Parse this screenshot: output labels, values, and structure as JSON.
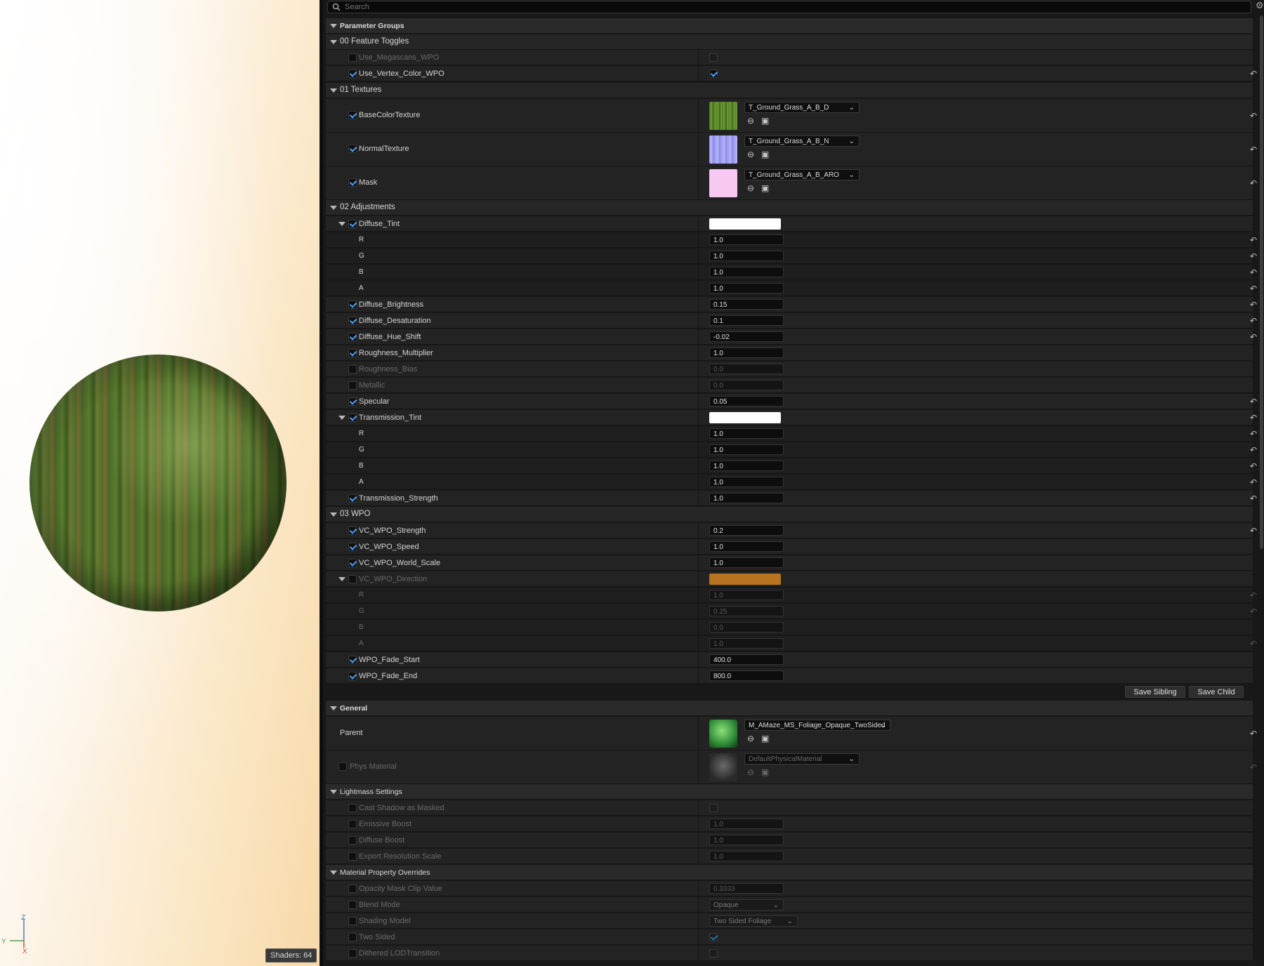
{
  "search": {
    "placeholder": "Search"
  },
  "viewport": {
    "shaders_label": "Shaders: 64",
    "axis": {
      "z": "Z",
      "y": "Y",
      "x": "X"
    }
  },
  "categories": {
    "parameter_groups": "Parameter Groups",
    "general": "General",
    "lightmass": "Lightmass Settings",
    "overrides": "Material Property Overrides"
  },
  "groups": {
    "feature_toggles": "00 Feature Toggles",
    "textures": "01 Textures",
    "adjustments": "02 Adjustments",
    "wpo": "03 WPO"
  },
  "feature_toggles": [
    {
      "name": "Use_Megascans_WPO",
      "enabled": false,
      "value_checked": false
    },
    {
      "name": "Use_Vertex_Color_WPO",
      "enabled": true,
      "value_checked": true
    }
  ],
  "textures": [
    {
      "name": "BaseColorTexture",
      "asset": "T_Ground_Grass_A_B_D",
      "thumb_color": "#5a8a2a"
    },
    {
      "name": "NormalTexture",
      "asset": "T_Ground_Grass_A_B_N",
      "thumb_color": "#9d9cf0"
    },
    {
      "name": "Mask",
      "asset": "T_Ground_Grass_A_B_ARO",
      "thumb_color": "#f6c8f2"
    }
  ],
  "adjustments": {
    "diffuse_tint": {
      "name": "Diffuse_Tint",
      "color": "#ffffff",
      "r": "1.0",
      "g": "1.0",
      "b": "1.0",
      "a": "1.0"
    },
    "diffuse_brightness": {
      "name": "Diffuse_Brightness",
      "value": "0.15"
    },
    "diffuse_desaturation": {
      "name": "Diffuse_Desaturation",
      "value": "0.1"
    },
    "diffuse_hue_shift": {
      "name": "Diffuse_Hue_Shift",
      "value": "-0.02"
    },
    "roughness_multiplier": {
      "name": "Roughness_Multiplier",
      "value": "1.0"
    },
    "roughness_bias": {
      "name": "Roughness_Bias",
      "value": "0.0"
    },
    "metallic": {
      "name": "Metallic",
      "value": "0.0"
    },
    "specular": {
      "name": "Specular",
      "value": "0.05"
    },
    "transmission_tint": {
      "name": "Transmission_Tint",
      "color": "#ffffff",
      "r": "1.0",
      "g": "1.0",
      "b": "1.0",
      "a": "1.0"
    },
    "transmission_strength": {
      "name": "Transmission_Strength",
      "value": "1.0"
    }
  },
  "channel_labels": {
    "r": "R",
    "g": "G",
    "b": "B",
    "a": "A"
  },
  "wpo": {
    "strength": {
      "name": "VC_WPO_Strength",
      "value": "0.2"
    },
    "speed": {
      "name": "VC_WPO_Speed",
      "value": "1.0"
    },
    "world_scale": {
      "name": "VC_WPO_World_Scale",
      "value": "1.0"
    },
    "direction": {
      "name": "VC_WPO_Direction",
      "color": "#b7731f",
      "r": "1.0",
      "g": "0.25",
      "b": "0.0",
      "a": "1.0"
    },
    "fade_start": {
      "name": "WPO_Fade_Start",
      "value": "400.0"
    },
    "fade_end": {
      "name": "WPO_Fade_End",
      "value": "800.0"
    }
  },
  "buttons": {
    "save_sibling": "Save Sibling",
    "save_child": "Save Child"
  },
  "general": {
    "parent_label": "Parent",
    "parent_asset": "M_AMaze_MS_Foliage_Opaque_TwoSided",
    "phys_label": "Phys Material",
    "phys_asset": "DefaultPhysicalMaterial"
  },
  "lightmass": {
    "cast_shadow": "Cast Shadow as Masked",
    "emissive_boost": {
      "name": "Emissive Boost",
      "value": "1.0"
    },
    "diffuse_boost": {
      "name": "Diffuse Boost",
      "value": "1.0"
    },
    "export_res": {
      "name": "Export Resolution Scale",
      "value": "1.0"
    }
  },
  "overrides": {
    "opacity_mask": {
      "name": "Opacity Mask Clip Value",
      "value": "0.3333"
    },
    "blend_mode": {
      "name": "Blend Mode",
      "value": "Opaque"
    },
    "shading_model": {
      "name": "Shading Model",
      "value": "Two Sided Foliage"
    },
    "two_sided": "Two Sided",
    "dithered": "Dithered LODTransition"
  },
  "colors": {
    "accent_check": "#4aa3ff",
    "panel_bg": "#181818",
    "row_bg": "#232323"
  }
}
